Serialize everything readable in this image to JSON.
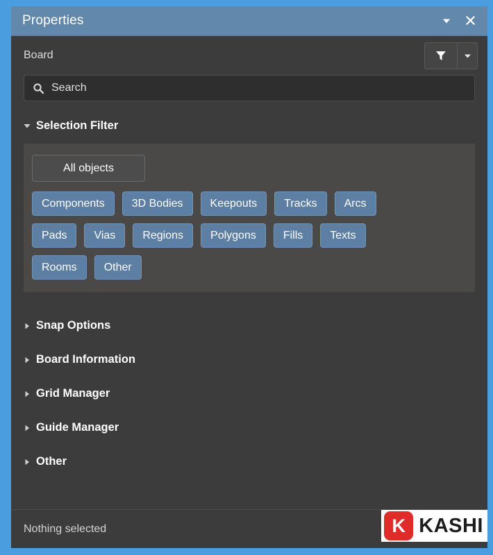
{
  "window": {
    "title": "Properties",
    "collapse_icon": "chevron-down-icon",
    "close_icon": "close-icon"
  },
  "header": {
    "object_type": "Board",
    "filter_icon": "funnel-icon",
    "filter_dropdown_icon": "chevron-down-icon"
  },
  "search": {
    "icon": "search-icon",
    "value": "",
    "placeholder": "Search"
  },
  "sections": {
    "selection_filter": {
      "label": "Selection Filter",
      "expanded": true,
      "all_objects_label": "All objects",
      "chip_rows": [
        [
          "Components",
          "3D Bodies",
          "Keepouts",
          "Tracks",
          "Arcs"
        ],
        [
          "Pads",
          "Vias",
          "Regions",
          "Polygons",
          "Fills",
          "Texts"
        ],
        [
          "Rooms",
          "Other"
        ]
      ]
    },
    "collapsed": [
      {
        "label": "Snap Options",
        "expanded": false
      },
      {
        "label": "Board Information",
        "expanded": false
      },
      {
        "label": "Grid Manager",
        "expanded": false
      },
      {
        "label": "Guide Manager",
        "expanded": false
      },
      {
        "label": "Other",
        "expanded": false
      }
    ]
  },
  "footer": {
    "status": "Nothing selected"
  },
  "watermark": {
    "badge": "K",
    "text": "KASHI"
  },
  "colors": {
    "dock_highlight": "#4a9ee0",
    "title_bar": "#6288ab",
    "panel_background": "#3d3c3c",
    "group_background": "#4a4948",
    "chip_blue": "#5d7fa3",
    "chip_neutral": "#4d4c4c",
    "search_background": "#2e2e2e",
    "watermark_red": "#e02b2b"
  }
}
